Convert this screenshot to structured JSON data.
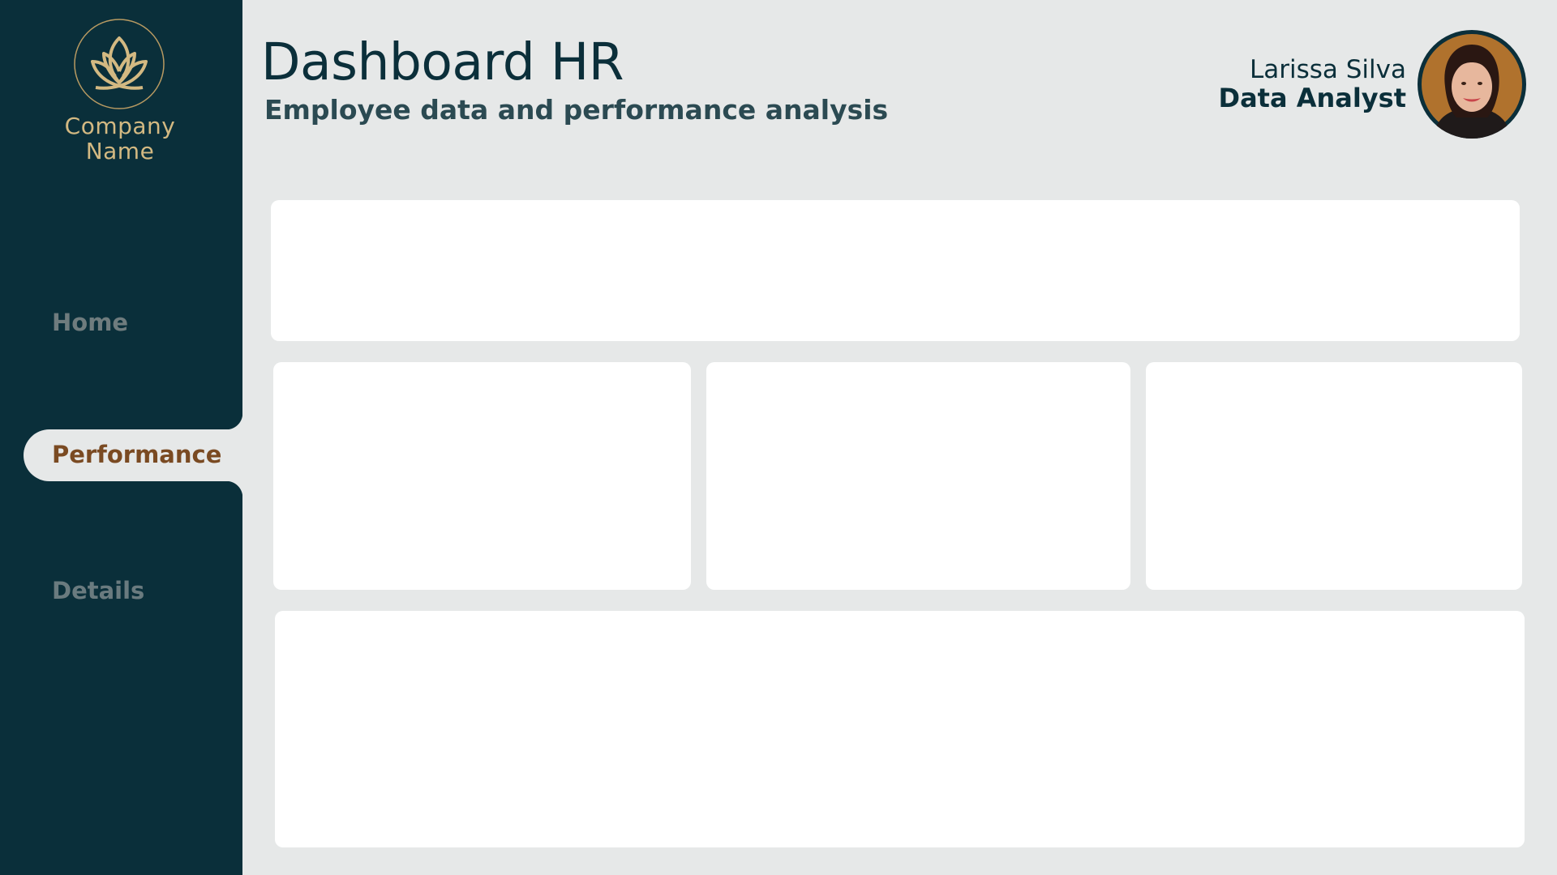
{
  "sidebar": {
    "company_name_line1": "Company",
    "company_name_line2": "Name",
    "logo_icon": "lotus-icon",
    "nav": {
      "home": "Home",
      "performance": "Performance",
      "details": "Details"
    },
    "active_item": "performance"
  },
  "header": {
    "title": "Dashboard HR",
    "subtitle": "Employee data and performance analysis"
  },
  "user": {
    "name": "Larissa Silva",
    "role": "Data Analyst"
  },
  "colors": {
    "sidebar": "#0a2f3a",
    "background": "#e6e8e8",
    "accent_gold": "#d3b982",
    "active_text": "#7a4a22",
    "card": "#ffffff"
  }
}
